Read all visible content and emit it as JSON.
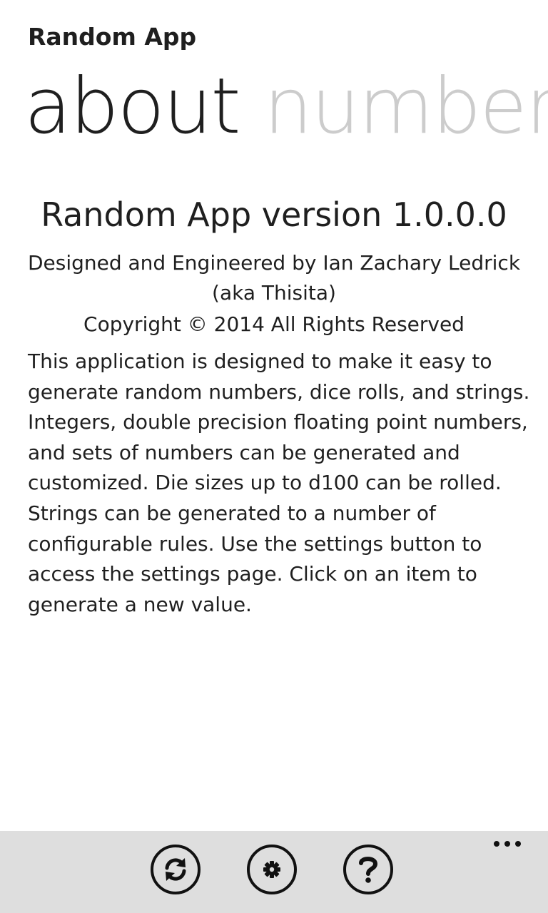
{
  "header": {
    "app_title": "Random App"
  },
  "pivot": {
    "items": [
      {
        "label": "about",
        "active": true
      },
      {
        "label": "numbers",
        "active": false
      }
    ]
  },
  "about": {
    "version": "Random App version 1.0.0.0",
    "credit": "Designed and Engineered by Ian Zachary Ledrick (aka Thisita)",
    "copyright": "Copyright ©  2014 All Rights Reserved",
    "description": "This application is designed to make it easy to generate random numbers, dice rolls, and strings. Integers, double precision floating point numbers, and sets of numbers can be generated and customized. Die sizes up to d100 can be rolled. Strings can be generated to a number of configurable rules. Use the settings button to access the settings page. Click on an item to generate a new value."
  },
  "app_bar": {
    "buttons": [
      {
        "icon": "refresh-icon"
      },
      {
        "icon": "gear-icon"
      },
      {
        "icon": "question-icon"
      }
    ],
    "more_icon": "ellipsis-icon",
    "background": "#dedede"
  },
  "colors": {
    "text": "#1f1f1f",
    "inactive_pivot": "#cccccc",
    "icon": "#111111"
  }
}
